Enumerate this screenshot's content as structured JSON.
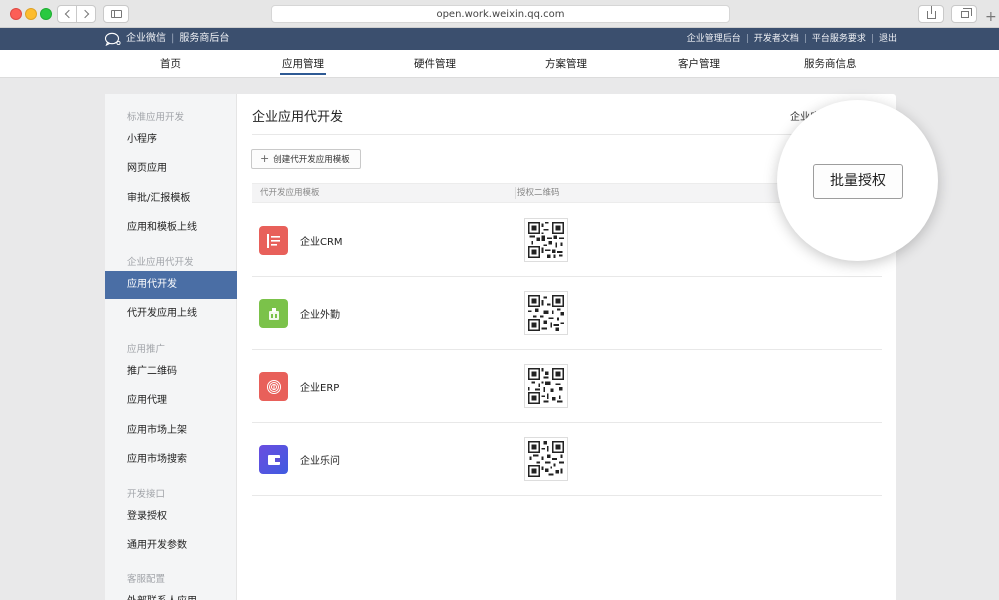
{
  "browser": {
    "url": "open.work.weixin.qq.com"
  },
  "topbar": {
    "brand": "企业微信",
    "brand_sub": "服务商后台",
    "links": [
      "企业管理后台",
      "开发者文档",
      "平台服务要求",
      "退出"
    ]
  },
  "mainnav": {
    "items": [
      "首页",
      "应用管理",
      "硬件管理",
      "方案管理",
      "客户管理",
      "服务商信息"
    ],
    "active": "应用管理"
  },
  "sidebar": {
    "groups": [
      {
        "label": "标准应用开发",
        "items": [
          "小程序",
          "网页应用",
          "审批/汇报模板",
          "应用和模板上线"
        ]
      },
      {
        "label": "企业应用代开发",
        "items": [
          "应用代开发",
          "代开发应用上线"
        ]
      },
      {
        "label": "应用推广",
        "items": [
          "推广二维码",
          "应用代理",
          "应用市场上架",
          "应用市场搜索"
        ]
      },
      {
        "label": "开发接口",
        "items": [
          "登录授权",
          "通用开发参数"
        ]
      },
      {
        "label": "客服配置",
        "items": [
          "外部联系人应用"
        ]
      }
    ],
    "active": "应用代开发"
  },
  "main": {
    "title": "企业应用代开发",
    "right_link": "企业应",
    "create_button": "创建代开发应用模板",
    "columns": [
      "代开发应用模板",
      "授权二维码"
    ],
    "rows": [
      {
        "name": "企业CRM",
        "icon": "crm-icon",
        "color": "#e8605a"
      },
      {
        "name": "企业外勤",
        "icon": "field-work-icon",
        "color": "#7bc24a"
      },
      {
        "name": "企业ERP",
        "icon": "erp-fingerprint-icon",
        "color": "#e8605a"
      },
      {
        "name": "企业乐问",
        "icon": "wallet-icon",
        "color": "#5b4fd6"
      }
    ]
  },
  "callout": {
    "button": "批量授权"
  },
  "colors": {
    "header": "#3b4f6e",
    "active_sidebar": "#4a6ea5",
    "nav_underline": "#2e5a94"
  }
}
